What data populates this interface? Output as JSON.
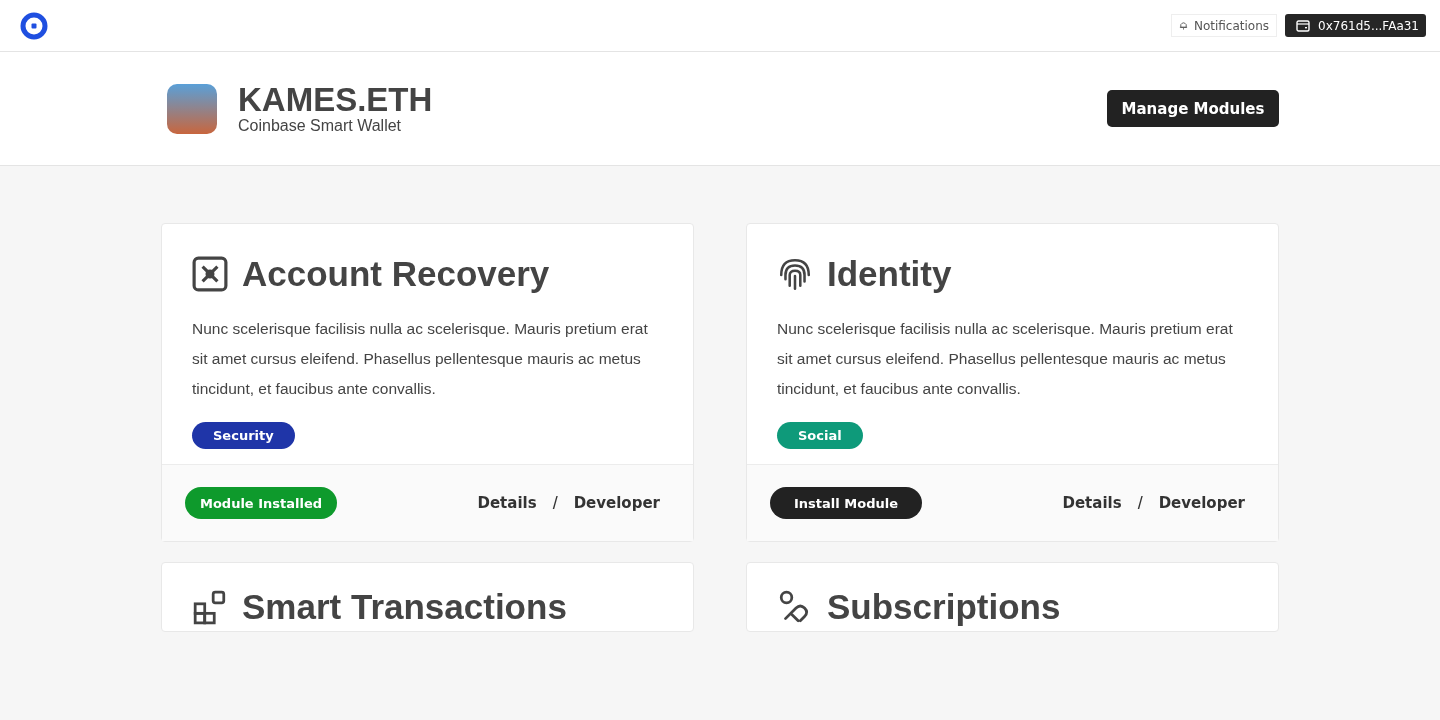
{
  "topbar": {
    "notifications": "Notifications",
    "wallet_address": "0x761d5...FAa31"
  },
  "profile": {
    "name": "KAMES.ETH",
    "subtitle": "Coinbase Smart Wallet",
    "action": "Manage Modules"
  },
  "modules": [
    {
      "title": "Account Recovery",
      "description": "Nunc scelerisque facilisis nulla ac scelerisque.  Mauris pretium erat sit amet cursus eleifend. Phasellus pellentesque mauris ac metus tincidunt, et faucibus ante convallis.",
      "tag": {
        "label": "Security",
        "color": "#1f35a8"
      },
      "installed": true,
      "action": "Module Installed",
      "links": [
        "Details",
        "Developer"
      ],
      "separator": "/"
    },
    {
      "title": "Identity",
      "description": "Nunc scelerisque facilisis nulla ac scelerisque.  Mauris pretium erat sit amet cursus eleifend. Phasellus pellentesque mauris ac metus tincidunt, et faucibus ante convallis.",
      "tag": {
        "label": "Social",
        "color": "#0e9a7a"
      },
      "installed": false,
      "action": "Install Module",
      "links": [
        "Details",
        "Developer"
      ],
      "separator": "/"
    },
    {
      "title": "Smart Transactions"
    },
    {
      "title": "Subscriptions"
    }
  ]
}
